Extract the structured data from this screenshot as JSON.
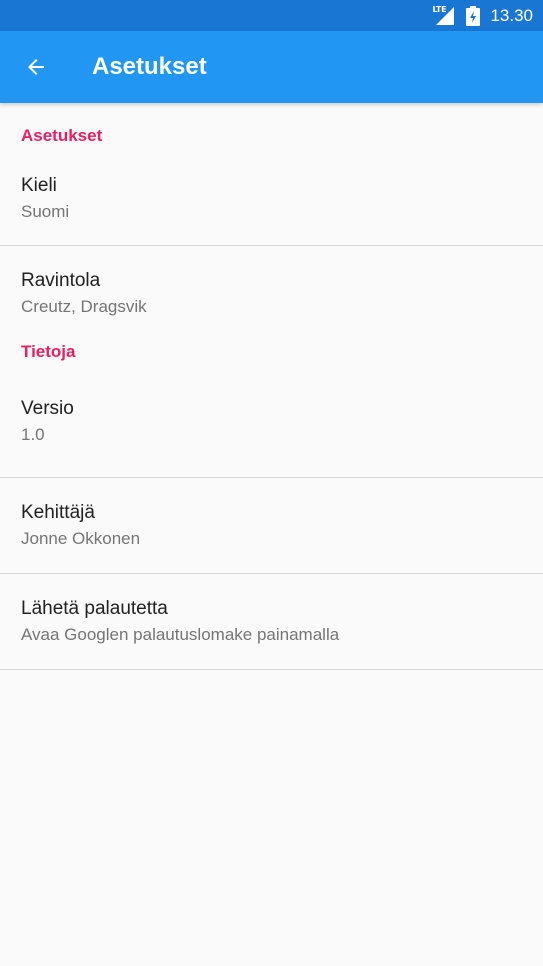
{
  "status_bar": {
    "network_label": "LTE",
    "time": "13.30"
  },
  "app_bar": {
    "title": "Asetukset"
  },
  "sections": [
    {
      "header": "Asetukset",
      "items": [
        {
          "title": "Kieli",
          "summary": "Suomi"
        },
        {
          "title": "Ravintola",
          "summary": "Creutz, Dragsvik"
        }
      ]
    },
    {
      "header": "Tietoja",
      "items": [
        {
          "title": "Versio",
          "summary": "1.0"
        },
        {
          "title": "Kehittäjä",
          "summary": "Jonne Okkonen"
        },
        {
          "title": "Lähetä palautetta",
          "summary": "Avaa Googlen palautuslomake painamalla"
        }
      ]
    }
  ],
  "colors": {
    "status_bar": "#1976d2",
    "app_bar": "#2196f3",
    "section_header": "#e91e63",
    "background": "#fafafa"
  }
}
